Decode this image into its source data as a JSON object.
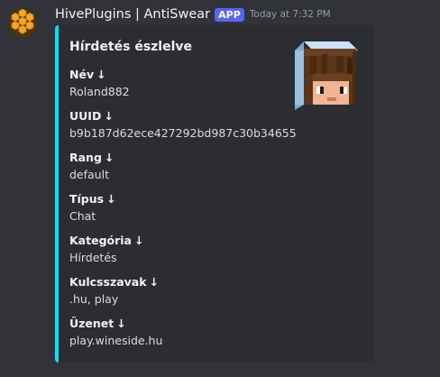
{
  "message": {
    "author": "HivePlugins | AntiSwear",
    "badge": "APP",
    "timestamp": "Today at 7:32 PM",
    "avatar_icon": "honeycomb-icon"
  },
  "embed": {
    "accent_color": "#00e5ff",
    "title": "Hírdetés észlelve",
    "thumbnail_icon": "minecraft-player-head-icon",
    "fields": [
      {
        "name": "Név",
        "arrow": "↓",
        "value": "Roland882"
      },
      {
        "name": "UUID",
        "arrow": "↓",
        "value": "b9b187d62ece427292bd987c30b34655"
      },
      {
        "name": "Rang",
        "arrow": "↓",
        "value": "default"
      },
      {
        "name": "Típus",
        "arrow": "↓",
        "value": "Chat"
      },
      {
        "name": "Kategória",
        "arrow": "↓",
        "value": "Hírdetés"
      },
      {
        "name": "Kulcsszavak",
        "arrow": "↓",
        "value": ".hu, play"
      },
      {
        "name": "Üzenet",
        "arrow": "↓",
        "value": "play.wineside.hu"
      }
    ]
  },
  "colors": {
    "background": "#313338",
    "embed_background": "#2b2d31",
    "badge": "#5865f2"
  }
}
